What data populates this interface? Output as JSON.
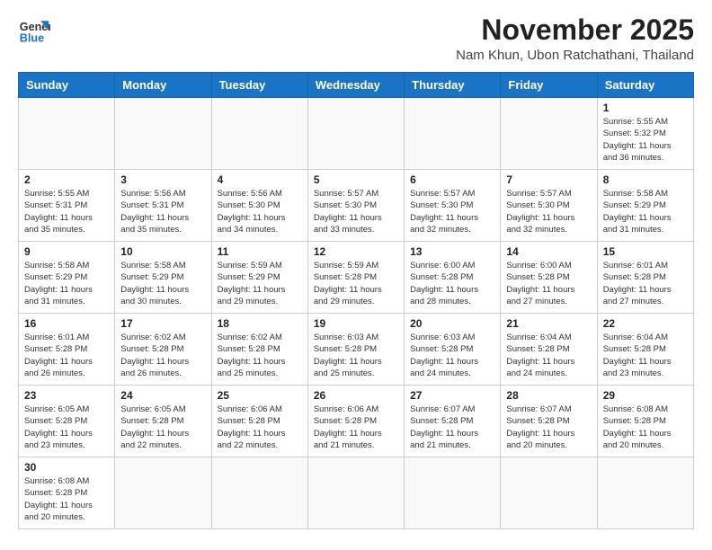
{
  "header": {
    "logo_line1": "General",
    "logo_line2": "Blue",
    "month_title": "November 2025",
    "location": "Nam Khun, Ubon Ratchathani, Thailand"
  },
  "weekdays": [
    "Sunday",
    "Monday",
    "Tuesday",
    "Wednesday",
    "Thursday",
    "Friday",
    "Saturday"
  ],
  "weeks": [
    [
      {
        "day": "",
        "info": ""
      },
      {
        "day": "",
        "info": ""
      },
      {
        "day": "",
        "info": ""
      },
      {
        "day": "",
        "info": ""
      },
      {
        "day": "",
        "info": ""
      },
      {
        "day": "",
        "info": ""
      },
      {
        "day": "1",
        "info": "Sunrise: 5:55 AM\nSunset: 5:32 PM\nDaylight: 11 hours\nand 36 minutes."
      }
    ],
    [
      {
        "day": "2",
        "info": "Sunrise: 5:55 AM\nSunset: 5:31 PM\nDaylight: 11 hours\nand 35 minutes."
      },
      {
        "day": "3",
        "info": "Sunrise: 5:56 AM\nSunset: 5:31 PM\nDaylight: 11 hours\nand 35 minutes."
      },
      {
        "day": "4",
        "info": "Sunrise: 5:56 AM\nSunset: 5:30 PM\nDaylight: 11 hours\nand 34 minutes."
      },
      {
        "day": "5",
        "info": "Sunrise: 5:57 AM\nSunset: 5:30 PM\nDaylight: 11 hours\nand 33 minutes."
      },
      {
        "day": "6",
        "info": "Sunrise: 5:57 AM\nSunset: 5:30 PM\nDaylight: 11 hours\nand 32 minutes."
      },
      {
        "day": "7",
        "info": "Sunrise: 5:57 AM\nSunset: 5:30 PM\nDaylight: 11 hours\nand 32 minutes."
      },
      {
        "day": "8",
        "info": "Sunrise: 5:58 AM\nSunset: 5:29 PM\nDaylight: 11 hours\nand 31 minutes."
      }
    ],
    [
      {
        "day": "9",
        "info": "Sunrise: 5:58 AM\nSunset: 5:29 PM\nDaylight: 11 hours\nand 31 minutes."
      },
      {
        "day": "10",
        "info": "Sunrise: 5:58 AM\nSunset: 5:29 PM\nDaylight: 11 hours\nand 30 minutes."
      },
      {
        "day": "11",
        "info": "Sunrise: 5:59 AM\nSunset: 5:29 PM\nDaylight: 11 hours\nand 29 minutes."
      },
      {
        "day": "12",
        "info": "Sunrise: 5:59 AM\nSunset: 5:28 PM\nDaylight: 11 hours\nand 29 minutes."
      },
      {
        "day": "13",
        "info": "Sunrise: 6:00 AM\nSunset: 5:28 PM\nDaylight: 11 hours\nand 28 minutes."
      },
      {
        "day": "14",
        "info": "Sunrise: 6:00 AM\nSunset: 5:28 PM\nDaylight: 11 hours\nand 27 minutes."
      },
      {
        "day": "15",
        "info": "Sunrise: 6:01 AM\nSunset: 5:28 PM\nDaylight: 11 hours\nand 27 minutes."
      }
    ],
    [
      {
        "day": "16",
        "info": "Sunrise: 6:01 AM\nSunset: 5:28 PM\nDaylight: 11 hours\nand 26 minutes."
      },
      {
        "day": "17",
        "info": "Sunrise: 6:02 AM\nSunset: 5:28 PM\nDaylight: 11 hours\nand 26 minutes."
      },
      {
        "day": "18",
        "info": "Sunrise: 6:02 AM\nSunset: 5:28 PM\nDaylight: 11 hours\nand 25 minutes."
      },
      {
        "day": "19",
        "info": "Sunrise: 6:03 AM\nSunset: 5:28 PM\nDaylight: 11 hours\nand 25 minutes."
      },
      {
        "day": "20",
        "info": "Sunrise: 6:03 AM\nSunset: 5:28 PM\nDaylight: 11 hours\nand 24 minutes."
      },
      {
        "day": "21",
        "info": "Sunrise: 6:04 AM\nSunset: 5:28 PM\nDaylight: 11 hours\nand 24 minutes."
      },
      {
        "day": "22",
        "info": "Sunrise: 6:04 AM\nSunset: 5:28 PM\nDaylight: 11 hours\nand 23 minutes."
      }
    ],
    [
      {
        "day": "23",
        "info": "Sunrise: 6:05 AM\nSunset: 5:28 PM\nDaylight: 11 hours\nand 23 minutes."
      },
      {
        "day": "24",
        "info": "Sunrise: 6:05 AM\nSunset: 5:28 PM\nDaylight: 11 hours\nand 22 minutes."
      },
      {
        "day": "25",
        "info": "Sunrise: 6:06 AM\nSunset: 5:28 PM\nDaylight: 11 hours\nand 22 minutes."
      },
      {
        "day": "26",
        "info": "Sunrise: 6:06 AM\nSunset: 5:28 PM\nDaylight: 11 hours\nand 21 minutes."
      },
      {
        "day": "27",
        "info": "Sunrise: 6:07 AM\nSunset: 5:28 PM\nDaylight: 11 hours\nand 21 minutes."
      },
      {
        "day": "28",
        "info": "Sunrise: 6:07 AM\nSunset: 5:28 PM\nDaylight: 11 hours\nand 20 minutes."
      },
      {
        "day": "29",
        "info": "Sunrise: 6:08 AM\nSunset: 5:28 PM\nDaylight: 11 hours\nand 20 minutes."
      }
    ],
    [
      {
        "day": "30",
        "info": "Sunrise: 6:08 AM\nSunset: 5:28 PM\nDaylight: 11 hours\nand 20 minutes."
      },
      {
        "day": "",
        "info": ""
      },
      {
        "day": "",
        "info": ""
      },
      {
        "day": "",
        "info": ""
      },
      {
        "day": "",
        "info": ""
      },
      {
        "day": "",
        "info": ""
      },
      {
        "day": "",
        "info": ""
      }
    ]
  ]
}
